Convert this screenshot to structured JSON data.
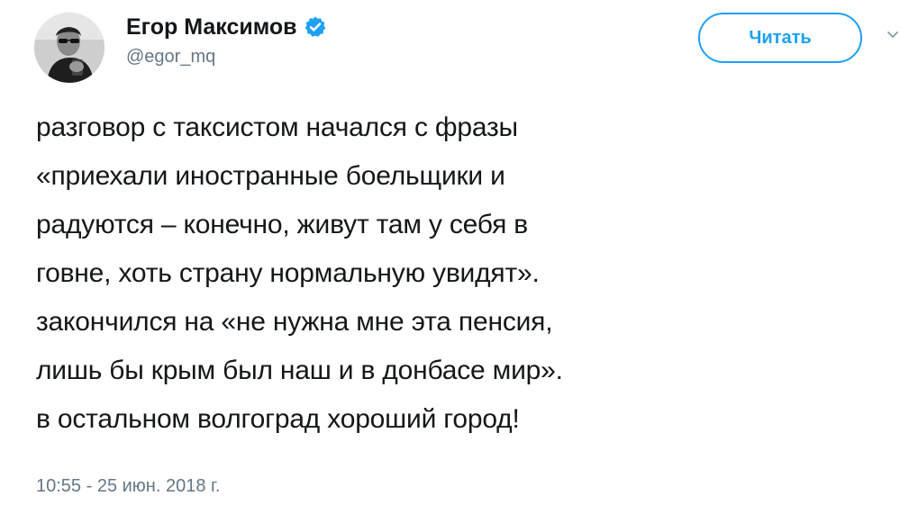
{
  "author": {
    "display_name": "Егор Максимов",
    "handle": "@egor_mq",
    "verified": true,
    "avatar": "profile-photo"
  },
  "follow_button": {
    "label": "Читать"
  },
  "menu": {
    "icon": "chevron-down-icon"
  },
  "tweet": {
    "lines": [
      "разговор с таксистом начался с фразы",
      "«приехали иностранные боельщики и",
      "радуются – конечно, живут там у себя в",
      "говне, хоть страну нормальную увидят».",
      "закончился на «не нужна мне эта пенсия,",
      "лишь бы крым был наш и в донбасе мир».",
      "в остальном волгоград хороший город!"
    ],
    "timestamp": "10:55 - 25 июн. 2018 г."
  },
  "colors": {
    "accent": "#1da1f2",
    "text": "#14171a",
    "secondary_text": "#657786"
  }
}
